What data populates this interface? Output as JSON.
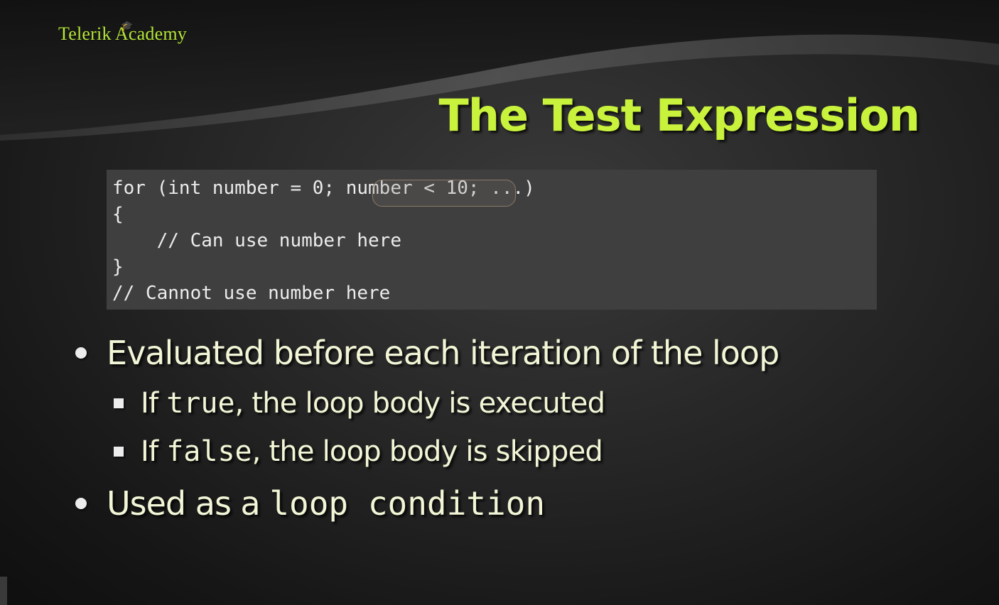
{
  "logo": {
    "text": "Telerik Academy"
  },
  "slide": {
    "title": "The Test Expression"
  },
  "code": {
    "lines": [
      "for (int number = 0; number < 10; ...)",
      "{",
      "    // Can use number here",
      "}",
      "// Cannot use number here"
    ],
    "highlighted": "number < 10;"
  },
  "bullets": {
    "b1": {
      "text": "Evaluated before each iteration of the loop"
    },
    "b2": {
      "prefix": "If ",
      "code": "true",
      "suffix": ", the loop body is executed"
    },
    "b3": {
      "prefix": "If ",
      "code": "false",
      "suffix": ", the loop body is skipped"
    },
    "b4": {
      "prefix": "Used as a ",
      "code": "loop condition"
    }
  },
  "colors": {
    "title": "#c8f23c",
    "logo": "#b6e63a",
    "bullet_text": "#f2f6d6",
    "code_bg": "#3f3f3f"
  }
}
